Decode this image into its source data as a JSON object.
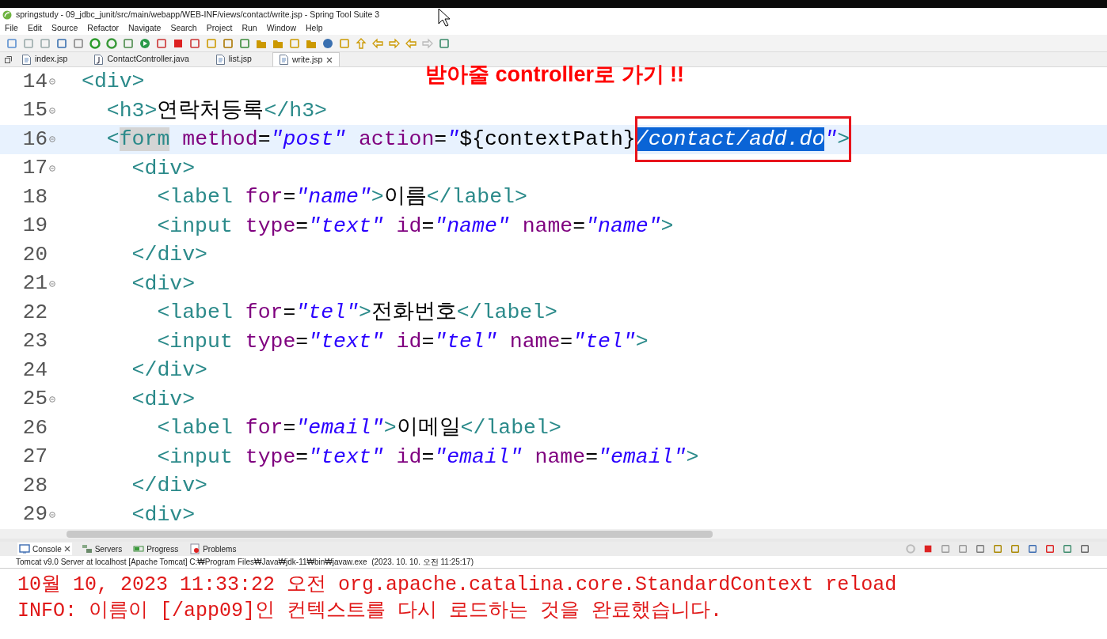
{
  "window": {
    "title": "springstudy - 09_jdbc_junit/src/main/webapp/WEB-INF/views/contact/write.jsp - Spring Tool Suite 3"
  },
  "menu": [
    "File",
    "Edit",
    "Source",
    "Refactor",
    "Navigate",
    "Search",
    "Project",
    "Run",
    "Window",
    "Help"
  ],
  "editor_tabs": [
    {
      "label": "index.jsp",
      "kind": "jsp",
      "selected": false
    },
    {
      "label": "ContactController.java",
      "kind": "java",
      "selected": false
    },
    {
      "label": "list.jsp",
      "kind": "jsp",
      "selected": false
    },
    {
      "label": "write.jsp",
      "kind": "jsp",
      "selected": true
    }
  ],
  "annotation": "받아줄 controller로 가기 !!",
  "code_lines": [
    {
      "number": "14",
      "foldable": true,
      "current": false,
      "tokens": [
        {
          "kind": "tag",
          "text": "<div>"
        }
      ]
    },
    {
      "number": "15",
      "foldable": true,
      "current": false,
      "tokens": [
        {
          "kind": "tag",
          "text": "  <h3>"
        },
        {
          "kind": "plain",
          "text": "연락처등록"
        },
        {
          "kind": "tag",
          "text": "</h3>"
        }
      ]
    },
    {
      "number": "16",
      "foldable": true,
      "current": true,
      "tokens": [
        {
          "kind": "tag",
          "text": "  <"
        },
        {
          "kind": "tag-match",
          "text": "form"
        },
        {
          "kind": "attr",
          "text": " method"
        },
        {
          "kind": "plain",
          "text": "="
        },
        {
          "kind": "value",
          "text": "\"post\""
        },
        {
          "kind": "attr",
          "text": " action"
        },
        {
          "kind": "plain",
          "text": "="
        },
        {
          "kind": "value",
          "text": "\""
        },
        {
          "kind": "plain",
          "text": "${contextPath}"
        },
        {
          "kind": "value-selected",
          "text": "/contact/add.do"
        },
        {
          "kind": "value",
          "text": "\""
        },
        {
          "kind": "tag",
          "text": ">"
        }
      ]
    },
    {
      "number": "17",
      "foldable": true,
      "current": false,
      "tokens": [
        {
          "kind": "tag",
          "text": "    <div>"
        }
      ]
    },
    {
      "number": "18",
      "foldable": false,
      "current": false,
      "tokens": [
        {
          "kind": "tag",
          "text": "      <label"
        },
        {
          "kind": "attr",
          "text": " for"
        },
        {
          "kind": "plain",
          "text": "="
        },
        {
          "kind": "value",
          "text": "\"name\""
        },
        {
          "kind": "tag",
          "text": ">"
        },
        {
          "kind": "plain",
          "text": "이름"
        },
        {
          "kind": "tag",
          "text": "</label>"
        }
      ]
    },
    {
      "number": "19",
      "foldable": false,
      "current": false,
      "tokens": [
        {
          "kind": "tag",
          "text": "      <input"
        },
        {
          "kind": "attr",
          "text": " type"
        },
        {
          "kind": "plain",
          "text": "="
        },
        {
          "kind": "value",
          "text": "\"text\""
        },
        {
          "kind": "attr",
          "text": " id"
        },
        {
          "kind": "plain",
          "text": "="
        },
        {
          "kind": "value",
          "text": "\"name\""
        },
        {
          "kind": "attr",
          "text": " name"
        },
        {
          "kind": "plain",
          "text": "="
        },
        {
          "kind": "value",
          "text": "\"name\""
        },
        {
          "kind": "tag",
          "text": ">"
        }
      ]
    },
    {
      "number": "20",
      "foldable": false,
      "current": false,
      "tokens": [
        {
          "kind": "tag",
          "text": "    </div>"
        }
      ]
    },
    {
      "number": "21",
      "foldable": true,
      "current": false,
      "tokens": [
        {
          "kind": "tag",
          "text": "    <div>"
        }
      ]
    },
    {
      "number": "22",
      "foldable": false,
      "current": false,
      "tokens": [
        {
          "kind": "tag",
          "text": "      <label"
        },
        {
          "kind": "attr",
          "text": " for"
        },
        {
          "kind": "plain",
          "text": "="
        },
        {
          "kind": "value",
          "text": "\"tel\""
        },
        {
          "kind": "tag",
          "text": ">"
        },
        {
          "kind": "plain",
          "text": "전화번호"
        },
        {
          "kind": "tag",
          "text": "</label>"
        }
      ]
    },
    {
      "number": "23",
      "foldable": false,
      "current": false,
      "tokens": [
        {
          "kind": "tag",
          "text": "      <input"
        },
        {
          "kind": "attr",
          "text": " type"
        },
        {
          "kind": "plain",
          "text": "="
        },
        {
          "kind": "value",
          "text": "\"text\""
        },
        {
          "kind": "attr",
          "text": " id"
        },
        {
          "kind": "plain",
          "text": "="
        },
        {
          "kind": "value",
          "text": "\"tel\""
        },
        {
          "kind": "attr",
          "text": " name"
        },
        {
          "kind": "plain",
          "text": "="
        },
        {
          "kind": "value",
          "text": "\"tel\""
        },
        {
          "kind": "tag",
          "text": ">"
        }
      ]
    },
    {
      "number": "24",
      "foldable": false,
      "current": false,
      "tokens": [
        {
          "kind": "tag",
          "text": "    </div>"
        }
      ]
    },
    {
      "number": "25",
      "foldable": true,
      "current": false,
      "tokens": [
        {
          "kind": "tag",
          "text": "    <div>"
        }
      ]
    },
    {
      "number": "26",
      "foldable": false,
      "current": false,
      "tokens": [
        {
          "kind": "tag",
          "text": "      <label"
        },
        {
          "kind": "attr",
          "text": " for"
        },
        {
          "kind": "plain",
          "text": "="
        },
        {
          "kind": "value",
          "text": "\"email\""
        },
        {
          "kind": "tag",
          "text": ">"
        },
        {
          "kind": "plain",
          "text": "이메일"
        },
        {
          "kind": "tag",
          "text": "</label>"
        }
      ]
    },
    {
      "number": "27",
      "foldable": false,
      "current": false,
      "tokens": [
        {
          "kind": "tag",
          "text": "      <input"
        },
        {
          "kind": "attr",
          "text": " type"
        },
        {
          "kind": "plain",
          "text": "="
        },
        {
          "kind": "value",
          "text": "\"text\""
        },
        {
          "kind": "attr",
          "text": " id"
        },
        {
          "kind": "plain",
          "text": "="
        },
        {
          "kind": "value",
          "text": "\"email\""
        },
        {
          "kind": "attr",
          "text": " name"
        },
        {
          "kind": "plain",
          "text": "="
        },
        {
          "kind": "value",
          "text": "\"email\""
        },
        {
          "kind": "tag",
          "text": ">"
        }
      ]
    },
    {
      "number": "28",
      "foldable": false,
      "current": false,
      "tokens": [
        {
          "kind": "tag",
          "text": "    </div>"
        }
      ]
    },
    {
      "number": "29",
      "foldable": true,
      "current": false,
      "tokens": [
        {
          "kind": "tag",
          "text": "    <div>"
        }
      ]
    }
  ],
  "console_tabs": [
    {
      "label": "Console",
      "kind": "console",
      "selected": true
    },
    {
      "label": "Servers",
      "kind": "servers",
      "selected": false
    },
    {
      "label": "Progress",
      "kind": "progress",
      "selected": false
    },
    {
      "label": "Problems",
      "kind": "problems",
      "selected": false
    }
  ],
  "console_header": "Tomcat v9.0 Server at localhost [Apache Tomcat] C:₩Program Files₩Java₩jdk-11₩bin₩javaw.exe  (2023. 10. 10. 오전 11:25:17)",
  "console_output": [
    "10월 10, 2023 11:33:22 오전 org.apache.catalina.core.StandardContext reload",
    "INFO: 이름이 [/app09]인 컨텍스트를 다시 로드하는 것을 완료했습니다."
  ]
}
